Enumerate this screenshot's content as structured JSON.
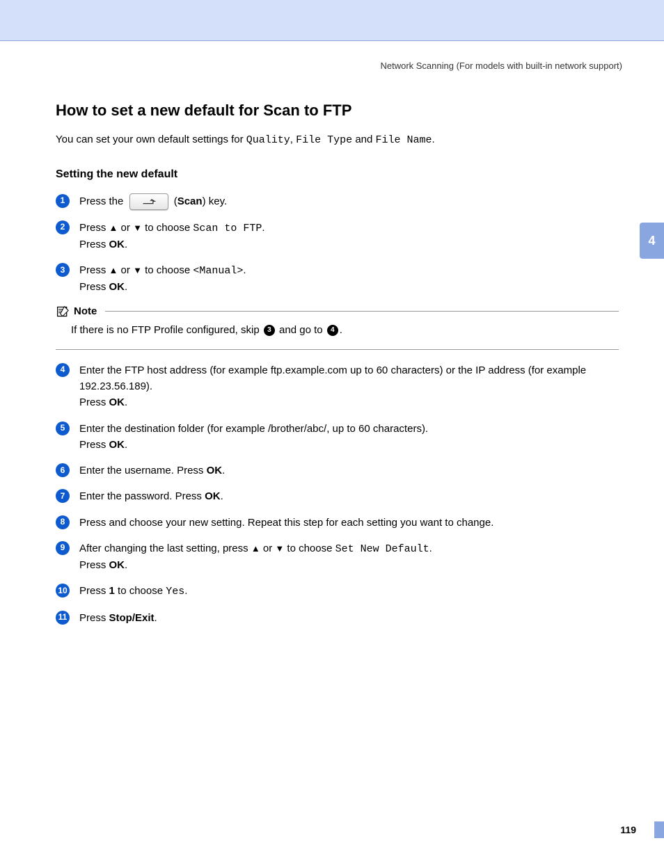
{
  "runningHead": "Network Scanning  (For models with built-in network support)",
  "title": "How to set a new default for Scan to FTP",
  "introPre": "You can set your own default settings for ",
  "introQuality": "Quality",
  "introSep1": ", ",
  "introFileType": "File Type",
  "introSep2": " and ",
  "introFileName": "File Name",
  "introEnd": ".",
  "subTitle": "Setting the new default",
  "step1_pre": "Press the ",
  "step1_post_open": " (",
  "step1_scan": "Scan",
  "step1_post_close": ") key.",
  "step2_a": "Press ",
  "step2_up": "▲",
  "step2_or": " or ",
  "step2_down": "▼",
  "step2_b": " to choose ",
  "step2_menu": "Scan to FTP",
  "step2_c": ".",
  "pressLabel": "Press ",
  "okLabel": "OK",
  "periodLabel": ".",
  "step3_b": " to choose ",
  "step3_menu": "<Manual>",
  "noteLabel": "Note",
  "noteBody_a": "If there is no FTP Profile configured, skip ",
  "noteBody_ref1": "3",
  "noteBody_b": " and go to ",
  "noteBody_ref2": "4",
  "noteBody_c": ".",
  "step4_a": "Enter the FTP host address (for example ftp.example.com up to 60 characters) or the IP address (for example 192.23.56.189).",
  "step5_a": "Enter the destination folder (for example /brother/abc/, up to 60 characters).",
  "step6_a": "Enter the username. Press ",
  "step7_a": "Enter the password. Press ",
  "step8_a": "Press and choose your new setting. Repeat this step for each setting you want to change.",
  "step9_a": "After changing the last setting, press ",
  "step9_b": " to choose ",
  "step9_menu": "Set New Default",
  "step10_a": "Press ",
  "step10_one": "1",
  "step10_b": " to choose ",
  "step10_yes": "Yes",
  "step11_a": "Press ",
  "step11_btn": "Stop/Exit",
  "sideTab": "4",
  "pageNum": "119",
  "bullets": {
    "b1": "1",
    "b2": "2",
    "b3": "3",
    "b4": "4",
    "b5": "5",
    "b6": "6",
    "b7": "7",
    "b8": "8",
    "b9": "9",
    "b10": "10",
    "b11": "11"
  }
}
